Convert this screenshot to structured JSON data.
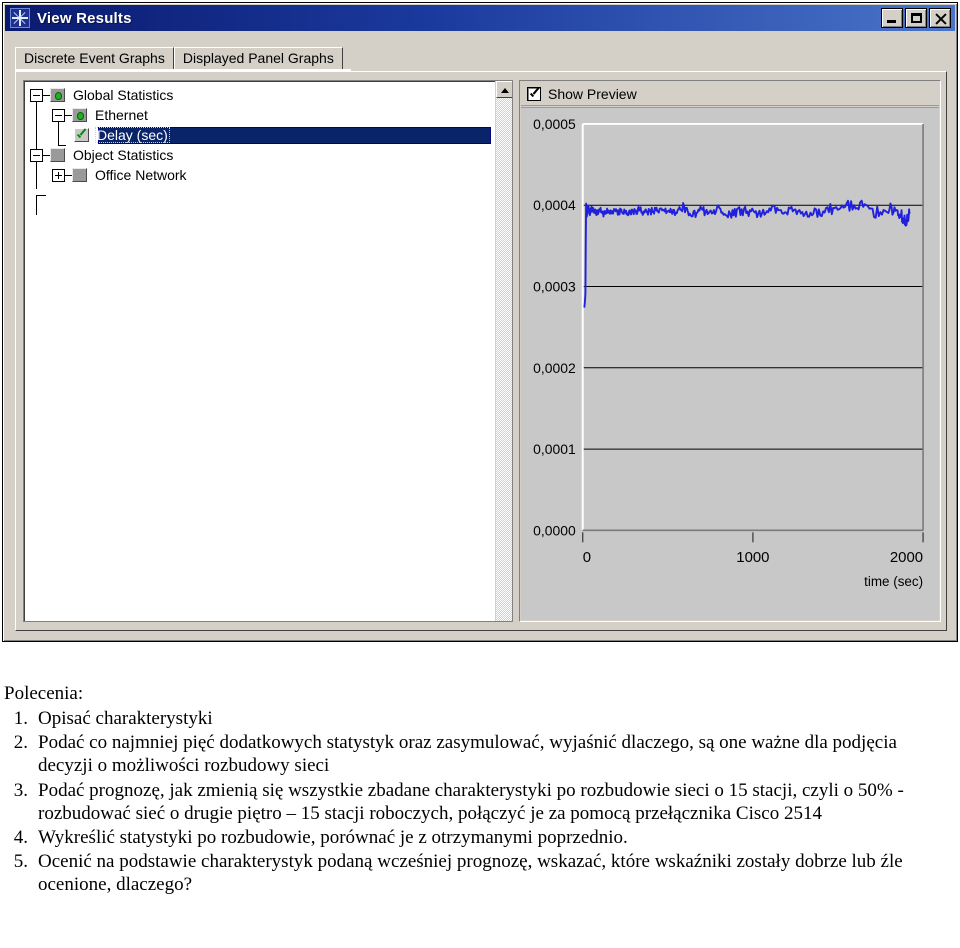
{
  "window": {
    "title": "View Results",
    "icon": "star-burst-icon",
    "controls": {
      "minimize": "Minimize",
      "maximize": "Maximize",
      "close": "Close"
    }
  },
  "tabs": [
    {
      "label": "Discrete Event Graphs",
      "active": true
    },
    {
      "label": "Displayed Panel Graphs",
      "active": false
    }
  ],
  "tree": {
    "nodes": [
      {
        "label": "Global Statistics",
        "level": 1,
        "expander": "minus",
        "icon": "folder-green-icon",
        "selected": false
      },
      {
        "label": "Ethernet",
        "level": 2,
        "expander": "minus",
        "icon": "folder-green-icon",
        "selected": false
      },
      {
        "label": "Delay (sec)",
        "level": 3,
        "expander": "none",
        "icon": "checkbox-checked-icon",
        "selected": true
      },
      {
        "label": "Object Statistics",
        "level": 1,
        "expander": "minus",
        "icon": "folder-plain-icon",
        "selected": false
      },
      {
        "label": "Office Network",
        "level": 2,
        "expander": "plus",
        "icon": "folder-plain-icon",
        "selected": false
      }
    ],
    "scrollbar": {
      "up_arrow": "scroll-up-icon"
    }
  },
  "preview": {
    "checkbox_label": "Show Preview",
    "checked": true
  },
  "chart_data": {
    "type": "line",
    "title": "",
    "xlabel": "time (sec)",
    "ylabel": "",
    "xlim": [
      0,
      2000
    ],
    "ylim": [
      0,
      0.0005
    ],
    "grid": true,
    "legend": false,
    "line_color": "#2020dd",
    "xticks": [
      0,
      1000,
      2000
    ],
    "xtick_labels": [
      "0",
      "1000",
      "2000"
    ],
    "yticks": [
      0.0,
      0.0001,
      0.0002,
      0.0003,
      0.0004,
      0.0005
    ],
    "ytick_labels": [
      "0,0000",
      "0,0001",
      "0,0002",
      "0,0003",
      "0,0004",
      "0,0005"
    ],
    "series": [
      {
        "name": "Ethernet Delay (sec)",
        "x": [
          10,
          14,
          16,
          18,
          20,
          24,
          28,
          34,
          42,
          52,
          66,
          82,
          100,
          122,
          146,
          172,
          200,
          230,
          262,
          296,
          332,
          370,
          410,
          452,
          496,
          542,
          590,
          640,
          692,
          746,
          802,
          860,
          920,
          982,
          1046,
          1112,
          1180,
          1250,
          1322,
          1396,
          1472,
          1550,
          1630,
          1712,
          1796,
          1850,
          1880,
          1900,
          1920
        ],
        "y": [
          0.000275,
          0.000284,
          0.000292,
          0.000358,
          0.000402,
          0.000386,
          0.000392,
          0.000397,
          0.000389,
          0.000396,
          0.000393,
          0.00039,
          0.000395,
          0.000388,
          0.000394,
          0.000392,
          0.000391,
          0.000393,
          0.00039,
          0.000392,
          0.000394,
          0.000391,
          0.000393,
          0.000392,
          0.000395,
          0.00039,
          0.000398,
          0.000386,
          0.000394,
          0.000391,
          0.000396,
          0.000388,
          0.000393,
          0.000392,
          0.00039,
          0.000395,
          0.000391,
          0.000394,
          0.000389,
          0.000392,
          0.000396,
          0.000399,
          0.000402,
          0.000391,
          0.000397,
          0.000393,
          0.000385,
          0.000381,
          0.00039
        ]
      }
    ]
  },
  "instructions": {
    "heading": "Polecenia:",
    "items": [
      {
        "num": "1.",
        "text": "Opisać charakterystyki"
      },
      {
        "num": "2.",
        "text": "Podać co najmniej pięć dodatkowych statystyk oraz zasymulować, wyjaśnić dlaczego, są one ważne dla podjęcia decyzji o możliwości rozbudowy sieci"
      },
      {
        "num": "3.",
        "text": "Podać prognozę, jak zmienią się wszystkie zbadane charakterystyki po rozbudowie sieci o 15 stacji, czyli o 50% - rozbudować sieć o drugie piętro – 15 stacji roboczych, połączyć je za pomocą przełącznika Cisco 2514"
      },
      {
        "num": "4.",
        "text": "Wykreślić statystyki po rozbudowie, porównać je z otrzymanymi poprzednio."
      },
      {
        "num": "5.",
        "text": "Ocenić na podstawie charakterystyk podaną wcześniej prognozę, wskazać, które wskaźniki zostały dobrze lub źle ocenione, dlaczego?"
      }
    ]
  }
}
